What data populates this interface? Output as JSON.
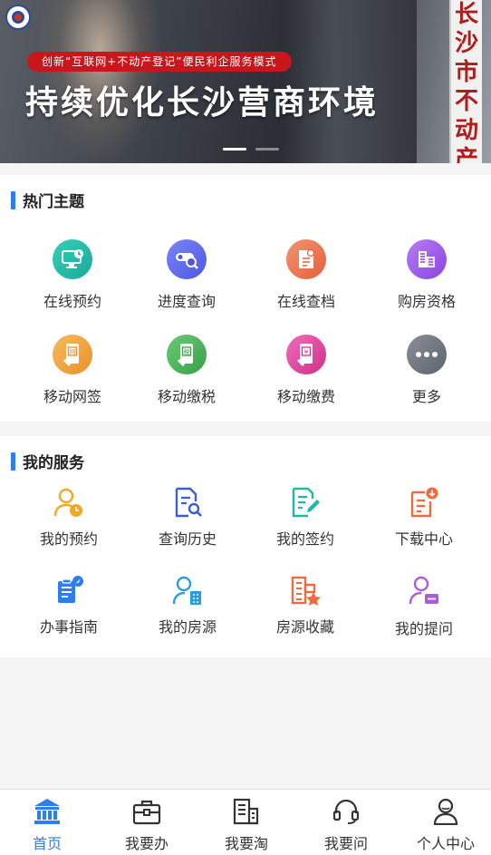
{
  "banner": {
    "tagline": "创新“互联网+不动产登记”便民利企服务模式",
    "headline": "持续优化长沙营商环境",
    "sign_text": [
      "长",
      "沙",
      "市",
      "不",
      "动",
      "产"
    ],
    "slides_total": 2,
    "active_slide": 1
  },
  "hot": {
    "title": "热门主题",
    "items": [
      {
        "label": "在线预约",
        "icon": "monitor-clock-icon",
        "color": "#21b9a6"
      },
      {
        "label": "进度查询",
        "icon": "progress-search-icon",
        "color": "#5f6df0"
      },
      {
        "label": "在线查档",
        "icon": "document-icon",
        "color": "#ee7a52"
      },
      {
        "label": "购房资格",
        "icon": "building-list-icon",
        "color": "#9d59ea"
      },
      {
        "label": "移动网签",
        "icon": "mobile-sign-icon",
        "color": "#f0a13b"
      },
      {
        "label": "移动缴税",
        "icon": "mobile-tax-icon",
        "color": "#46b455"
      },
      {
        "label": "移动缴费",
        "icon": "mobile-pay-icon",
        "color": "#e0449c"
      },
      {
        "label": "更多",
        "icon": "more-icon",
        "color": "#6e7380"
      }
    ]
  },
  "services": {
    "title": "我的服务",
    "items": [
      {
        "label": "我的预约",
        "icon": "user-clock-icon",
        "color": "#f5a623"
      },
      {
        "label": "查询历史",
        "icon": "document-search-icon",
        "color": "#3a5fd0"
      },
      {
        "label": "我的签约",
        "icon": "document-edit-icon",
        "color": "#1fb7a5"
      },
      {
        "label": "下载中心",
        "icon": "document-download-icon",
        "color": "#ef6b3f"
      },
      {
        "label": "办事指南",
        "icon": "guide-icon",
        "color": "#2d7ef0"
      },
      {
        "label": "我的房源",
        "icon": "user-building-icon",
        "color": "#2a9de0"
      },
      {
        "label": "房源收藏",
        "icon": "building-star-icon",
        "color": "#ef6b3f"
      },
      {
        "label": "我的提问",
        "icon": "user-question-icon",
        "color": "#b05ad8"
      }
    ]
  },
  "tabs": [
    {
      "label": "首页",
      "icon": "home-bank-icon",
      "active": true
    },
    {
      "label": "我要办",
      "icon": "briefcase-icon",
      "active": false
    },
    {
      "label": "我要淘",
      "icon": "document-building-icon",
      "active": false
    },
    {
      "label": "我要问",
      "icon": "headset-icon",
      "active": false
    },
    {
      "label": "个人中心",
      "icon": "user-icon",
      "active": false
    }
  ],
  "colors": {
    "accent": "#2d7ef0",
    "banner_red": "#c7161c"
  }
}
